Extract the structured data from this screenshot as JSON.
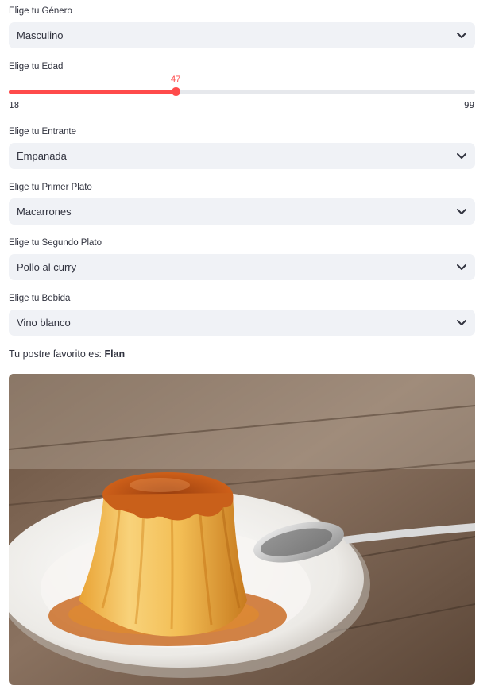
{
  "gender": {
    "label": "Elige tu Género",
    "value": "Masculino"
  },
  "age": {
    "label": "Elige tu Edad",
    "value": 47,
    "min": 18,
    "max": 99,
    "min_label": "18",
    "max_label": "99",
    "value_label": "47"
  },
  "starter": {
    "label": "Elige tu Entrante",
    "value": "Empanada"
  },
  "main_course": {
    "label": "Elige tu Primer Plato",
    "value": "Macarrones"
  },
  "second_course": {
    "label": "Elige tu Segundo Plato",
    "value": "Pollo al curry"
  },
  "drink": {
    "label": "Elige tu Bebida",
    "value": "Vino blanco"
  },
  "dessert": {
    "prefix": "Tu postre favorito es: ",
    "value": "Flan"
  },
  "icons": {
    "dropdown": "chevron-down-icon"
  },
  "colors": {
    "accent": "#ff4b4b",
    "select_bg": "#f0f2f6",
    "text": "#31333f"
  }
}
